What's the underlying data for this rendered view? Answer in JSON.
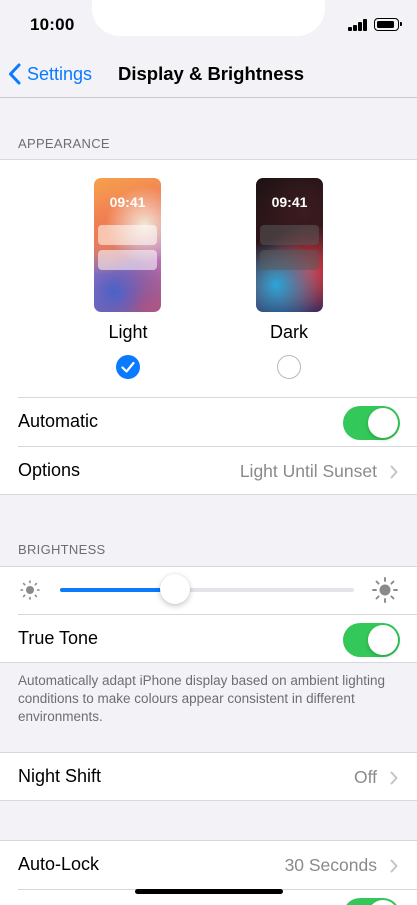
{
  "status_bar": {
    "time": "10:00"
  },
  "nav": {
    "back_label": "Settings",
    "title": "Display & Brightness"
  },
  "appearance": {
    "header": "APPEARANCE",
    "light": {
      "preview_time": "09:41",
      "label": "Light",
      "selected": true
    },
    "dark": {
      "preview_time": "09:41",
      "label": "Dark",
      "selected": false
    },
    "automatic": {
      "label": "Automatic",
      "on": true
    },
    "options": {
      "label": "Options",
      "value": "Light Until Sunset"
    }
  },
  "brightness": {
    "header": "BRIGHTNESS",
    "level": 0.39,
    "true_tone": {
      "label": "True Tone",
      "on": true
    },
    "footer": "Automatically adapt iPhone display based on ambient lighting conditions to make colours appear consistent in different environments."
  },
  "night_shift": {
    "label": "Night Shift",
    "value": "Off"
  },
  "auto_lock": {
    "label": "Auto-Lock",
    "value": "30 Seconds"
  },
  "colors": {
    "accent": "#0a7aff",
    "toggle_on": "#34c759",
    "secondary_text": "#8a8a8e"
  }
}
